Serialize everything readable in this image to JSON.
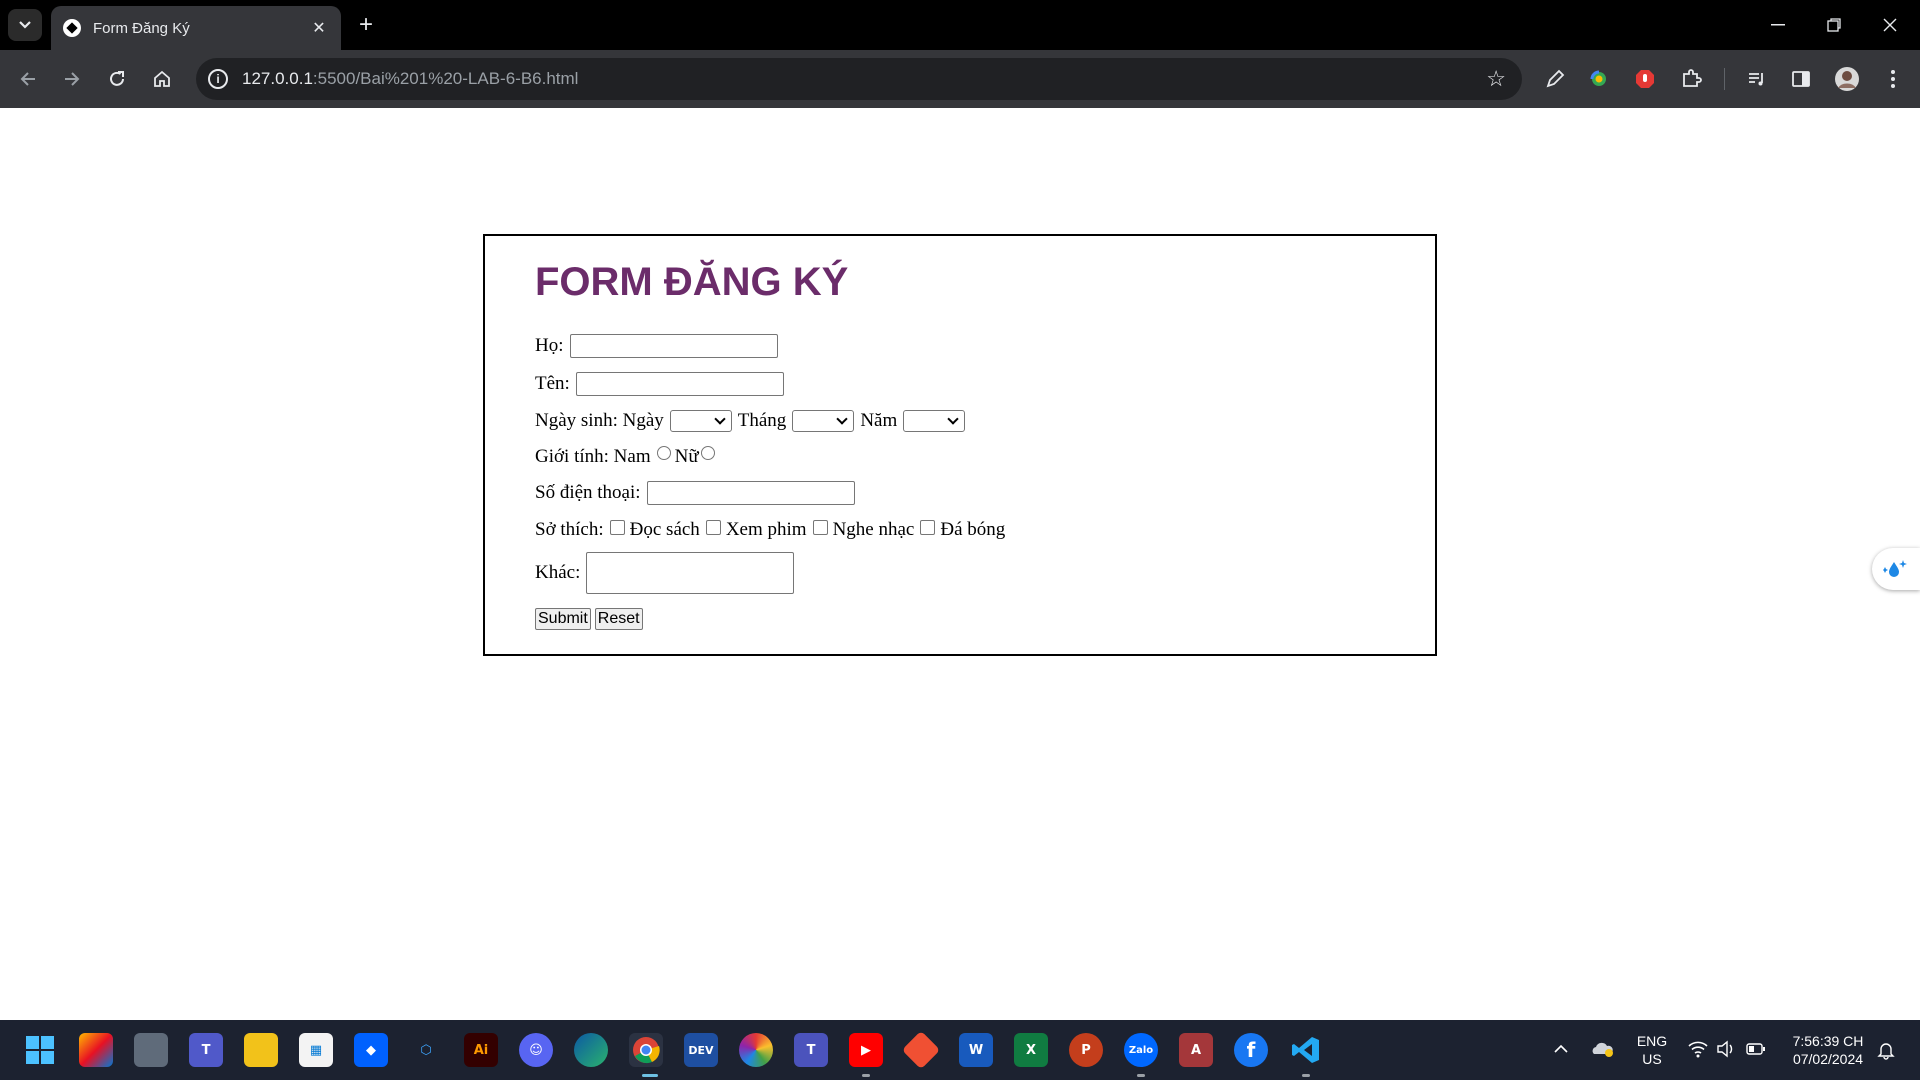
{
  "browser": {
    "tab_title": "Form Đăng Ký",
    "url_host": "127.0.0.1",
    "url_path": ":5500/Bai%201%20-LAB-6-B6.html"
  },
  "form": {
    "title": "FORM ĐĂNG KÝ",
    "ho_label": "Họ:",
    "ten_label": "Tên:",
    "ngaysinh_label": "Ngày sinh: Ngày",
    "thang_label": "Tháng",
    "nam_label": "Năm",
    "gioitinh_label": "Giới tính: Nam",
    "nu_label": "Nữ",
    "sdt_label": "Số điện thoại:",
    "sothich_label": "Sở thích:",
    "hobbies": [
      "Đọc sách",
      "Xem phim",
      "Nghe nhạc",
      "Đá bóng"
    ],
    "khac_label": "Khác:",
    "submit_label": "Submit",
    "reset_label": "Reset"
  },
  "taskbar": {
    "lang_line1": "ENG",
    "lang_line2": "US",
    "time": "7:56:39 CH",
    "date": "07/02/2024"
  },
  "colors": {
    "title": "#6b2c6a",
    "taskbar": "#1c2230",
    "tabbar": "#000000",
    "toolbar": "#35363a"
  }
}
